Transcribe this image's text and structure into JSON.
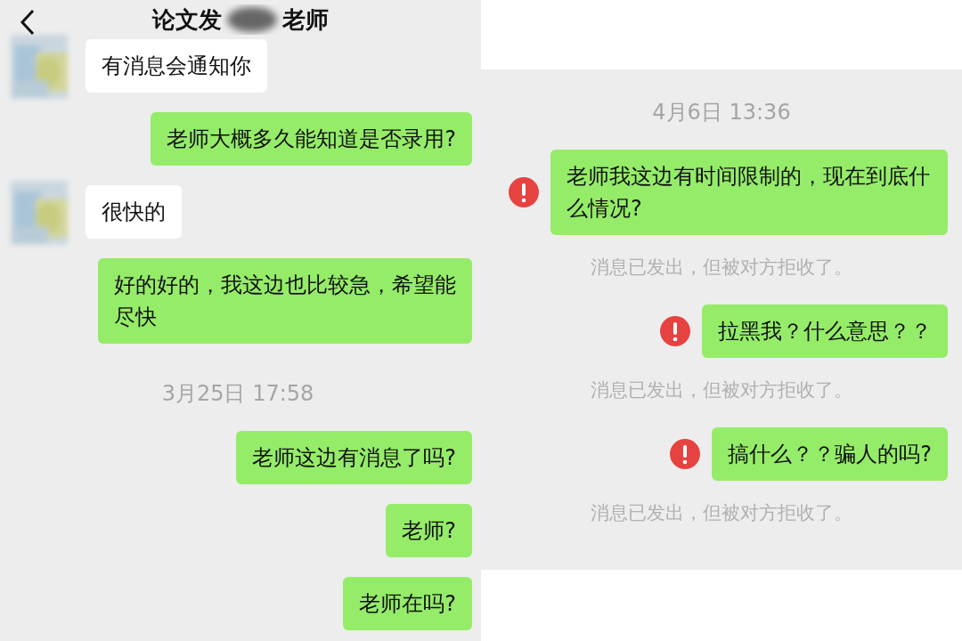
{
  "left_chat": {
    "header": {
      "title_start": "论文发",
      "title_end": "老师"
    },
    "messages": [
      {
        "kind": "received",
        "text": "有消息会通知你"
      },
      {
        "kind": "sent",
        "text": "老师大概多久能知道是否录用?",
        "failed": false
      },
      {
        "kind": "received",
        "text": "很快的"
      },
      {
        "kind": "sent",
        "text": "好的好的，我这边也比较急，希望能尽快",
        "failed": false
      },
      {
        "kind": "time",
        "text": "3月25日 17:58"
      },
      {
        "kind": "sent",
        "text": "老师这边有消息了吗?",
        "failed": false
      },
      {
        "kind": "sent",
        "text": "老师?",
        "failed": false
      },
      {
        "kind": "sent",
        "text": "老师在吗?",
        "failed": false
      }
    ]
  },
  "right_chat": {
    "messages": [
      {
        "kind": "time",
        "text": "4月6日 13:36"
      },
      {
        "kind": "sent",
        "text": "老师我这边有时间限制的，现在到底什么情况?",
        "failed": true
      },
      {
        "kind": "notice",
        "text": "消息已发出，但被对方拒收了。"
      },
      {
        "kind": "sent",
        "text": "拉黑我？什么意思？？",
        "failed": true
      },
      {
        "kind": "notice",
        "text": "消息已发出，但被对方拒收了。"
      },
      {
        "kind": "sent",
        "text": "搞什么？？骗人的吗?",
        "failed": true
      },
      {
        "kind": "notice",
        "text": "消息已发出，但被对方拒收了。"
      }
    ]
  }
}
